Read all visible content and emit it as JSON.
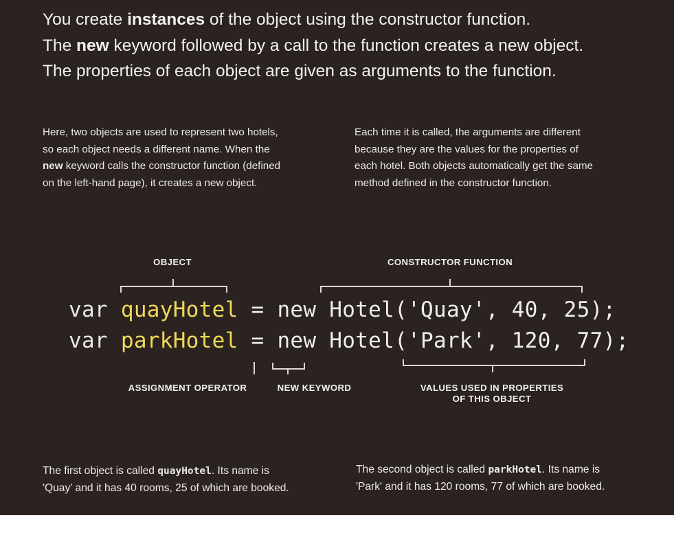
{
  "intro": {
    "line1": {
      "a": "You create ",
      "b": "instances",
      "c": " of the object using the constructor function."
    },
    "line2": {
      "a": "The ",
      "b": "new",
      "c": " keyword followed by a call to the function creates a new object."
    },
    "line3": "The properties of each object are given as arguments to the function."
  },
  "left_paragraph": {
    "line1": "Here, two objects are used to represent two hotels,",
    "line2": "so each object needs a different name. When the",
    "line3_bold": "new",
    "line3_rest": " keyword calls the constructor function (defined",
    "line4": "on the left-hand page), it creates a new object."
  },
  "right_paragraph": {
    "line1": "Each time it is called, the arguments are different",
    "line2": "because they are the values for the properties of",
    "line3": "each hotel. Both objects automatically get the same",
    "line4": "method defined in the constructor function."
  },
  "labels": {
    "object": "OBJECT",
    "constructor": "CONSTRUCTOR FUNCTION",
    "assignment": "ASSIGNMENT OPERATOR",
    "new_keyword": "NEW KEYWORD",
    "values_line1": "VALUES USED IN PROPERTIES",
    "values_line2": "OF THIS OBJECT"
  },
  "code": {
    "line1": {
      "var": "var ",
      "name": "quayHotel",
      "rest": " = new Hotel('Quay', 40, 25);"
    },
    "line2": {
      "var": "var ",
      "name": "parkHotel",
      "rest": " = new Hotel('Park', 120, 77);"
    }
  },
  "captions": {
    "left": {
      "a": "The first object is called ",
      "code": "quayHotel",
      "b": ". Its name is",
      "line2": "'Quay' and it has 40 rooms, 25 of which are booked."
    },
    "right": {
      "a": "The second object is called ",
      "code": "parkHotel",
      "b": ". Its name is",
      "line2": "'Park' and it has 120 rooms, 77 of which are booked."
    }
  },
  "colors": {
    "background": "#2a2320",
    "highlight": "#f2d85a",
    "text": "#f2f0ec"
  }
}
